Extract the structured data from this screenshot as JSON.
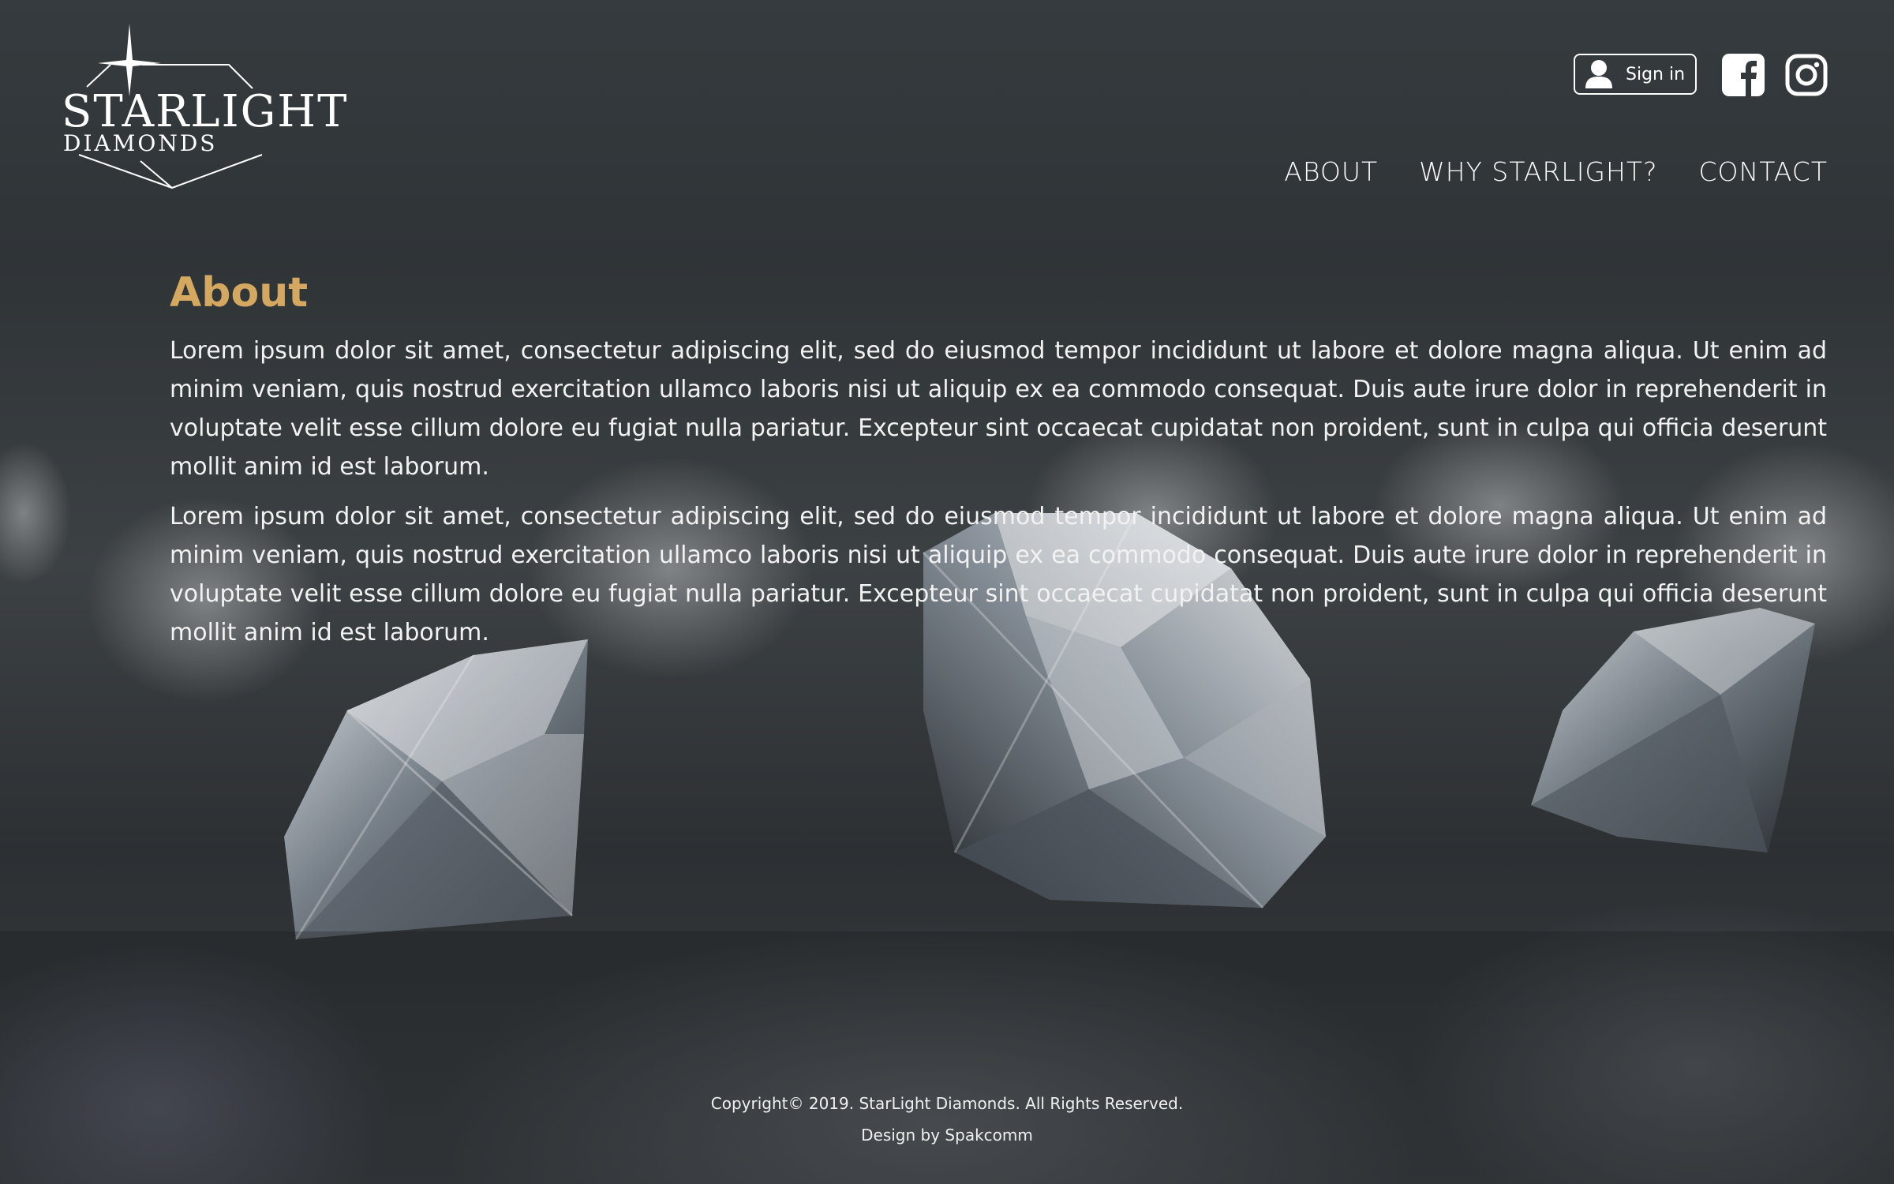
{
  "brand": {
    "title": "STARLIGHT",
    "subtitle": "DIAMONDS"
  },
  "header": {
    "signin_label": "Sign in",
    "social": [
      {
        "icon": "facebook-icon"
      },
      {
        "icon": "instagram-icon"
      }
    ]
  },
  "nav": {
    "items": [
      {
        "label": "ABOUT"
      },
      {
        "label": "WHY STARLIGHT?"
      },
      {
        "label": "CONTACT"
      }
    ]
  },
  "main": {
    "heading": "About",
    "paragraphs": [
      "Lorem ipsum dolor sit amet, consectetur adipiscing elit, sed do eiusmod tempor incididunt ut labore et dolore magna aliqua. Ut enim ad minim veniam, quis nostrud exercitation ullamco laboris nisi ut aliquip ex ea commodo consequat. Duis aute irure dolor in reprehenderit in voluptate velit esse cillum dolore eu fugiat nulla pariatur. Excepteur sint occaecat cupidatat non proident, sunt in culpa qui officia deserunt mollit anim id est laborum.",
      "Lorem ipsum dolor sit amet, consectetur adipiscing elit, sed do eiusmod tempor incididunt ut labore et dolore magna aliqua. Ut enim ad minim veniam, quis nostrud exercitation ullamco laboris nisi ut aliquip ex ea commodo consequat. Duis aute irure dolor in reprehenderit in voluptate velit esse cillum dolore eu fugiat nulla pariatur. Excepteur sint occaecat cupidatat non proident, sunt in culpa qui officia deserunt mollit anim id est laborum."
    ]
  },
  "footer": {
    "copyright": "Copyright© 2019. StarLight Diamonds. All Rights Reserved.",
    "credit": "Design by Spakcomm"
  },
  "colors": {
    "accent": "#d4a860",
    "text": "#ffffff",
    "background": "#2f3437"
  }
}
